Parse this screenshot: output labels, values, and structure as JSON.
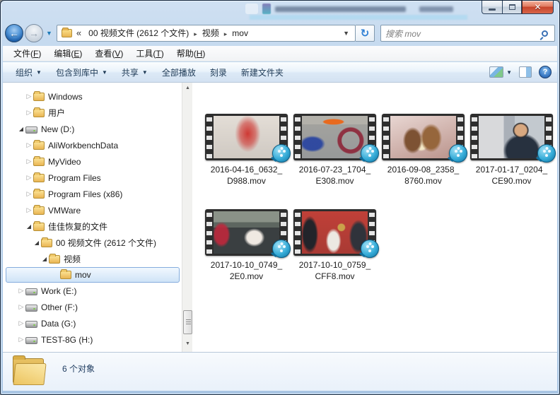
{
  "window": {
    "controls": {
      "minimize": "minimize",
      "maximize": "restore",
      "close": "close"
    }
  },
  "nav": {
    "breadcrumb": {
      "overflow": "«",
      "items": [
        "00 视频文件  (2612 个文件)",
        "视频",
        "mov"
      ],
      "separator": "▸",
      "dropdown_caret": "▼"
    },
    "refresh_icon": "↻",
    "search": {
      "placeholder": "搜索 mov"
    }
  },
  "menubar": {
    "items": [
      "文件(F)",
      "编辑(E)",
      "查看(V)",
      "工具(T)",
      "帮助(H)"
    ]
  },
  "toolbar": {
    "items": [
      {
        "label": "组织",
        "dropdown": true
      },
      {
        "label": "包含到库中",
        "dropdown": true
      },
      {
        "label": "共享",
        "dropdown": true
      },
      {
        "label": "全部播放",
        "dropdown": false
      },
      {
        "label": "刻录",
        "dropdown": false
      },
      {
        "label": "新建文件夹",
        "dropdown": false
      }
    ],
    "caret": "▼"
  },
  "tree": {
    "items": [
      {
        "label": "Windows",
        "icon": "folder",
        "expand": "collapsed",
        "level": 1,
        "selected": false
      },
      {
        "label": "用户",
        "icon": "folder",
        "expand": "collapsed",
        "level": 1,
        "selected": false
      },
      {
        "label": "New (D:)",
        "icon": "drive",
        "expand": "expanded",
        "level": 0,
        "selected": false
      },
      {
        "label": "AliWorkbenchData",
        "icon": "folder",
        "expand": "collapsed",
        "level": 1,
        "selected": false
      },
      {
        "label": "MyVideo",
        "icon": "folder",
        "expand": "collapsed",
        "level": 1,
        "selected": false
      },
      {
        "label": "Program Files",
        "icon": "folder",
        "expand": "collapsed",
        "level": 1,
        "selected": false
      },
      {
        "label": "Program Files (x86)",
        "icon": "folder",
        "expand": "collapsed",
        "level": 1,
        "selected": false
      },
      {
        "label": "VMWare",
        "icon": "folder",
        "expand": "collapsed",
        "level": 1,
        "selected": false
      },
      {
        "label": "佳佳恢复的文件",
        "icon": "folder",
        "expand": "expanded",
        "level": 1,
        "selected": false
      },
      {
        "label": "00 视频文件  (2612 个文件)",
        "icon": "folder",
        "expand": "expanded",
        "level": 2,
        "selected": false
      },
      {
        "label": "视频",
        "icon": "folder",
        "expand": "expanded",
        "level": 3,
        "selected": false
      },
      {
        "label": "mov",
        "icon": "folder",
        "expand": "none",
        "level": 4,
        "selected": true
      },
      {
        "label": "Work (E:)",
        "icon": "drive",
        "expand": "collapsed",
        "level": 0,
        "selected": false
      },
      {
        "label": "Other (F:)",
        "icon": "drive",
        "expand": "collapsed",
        "level": 0,
        "selected": false
      },
      {
        "label": "Data (G:)",
        "icon": "drive",
        "expand": "collapsed",
        "level": 0,
        "selected": false
      },
      {
        "label": "TEST-8G (H:)",
        "icon": "drive",
        "expand": "collapsed",
        "level": 0,
        "selected": false
      }
    ],
    "twist_collapsed": "▷",
    "twist_expanded": "◢"
  },
  "files": {
    "items": [
      {
        "name": "2016-04-16_0632_D988.mov",
        "scene": "scene-redchar"
      },
      {
        "name": "2016-07-23_1704_E308.mov",
        "scene": "scene-crowd"
      },
      {
        "name": "2016-09-08_2358_8760.mov",
        "scene": "scene-bears"
      },
      {
        "name": "2017-01-17_0204_CE90.mov",
        "scene": "scene-selfie"
      },
      {
        "name": "2017-10-10_0749_2E0.mov",
        "scene": "scene-car"
      },
      {
        "name": "2017-10-10_0759_CFF8.mov",
        "scene": "scene-room"
      }
    ]
  },
  "statusbar": {
    "text": "6 个对象"
  },
  "colors": {
    "glass_frame": "#a9c6e4",
    "selection_fill": "#cfe4f7",
    "selection_border": "#84acdd",
    "close_button_red": "#c6442b",
    "command_text": "#1f3b57",
    "folder_yellow": "#e9b553",
    "badge_blue": "#36acd8"
  }
}
